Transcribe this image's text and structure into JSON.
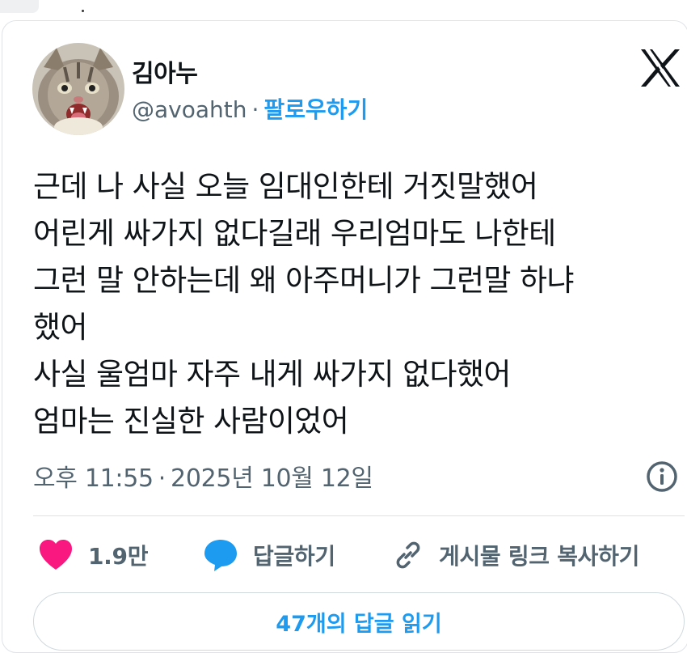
{
  "tweet": {
    "author": {
      "display_name": "김아누",
      "handle": "@avoahth",
      "follow_label": "팔로우하기",
      "avatar_icon": "cat-avatar"
    },
    "brand_icon": "x-logo-icon",
    "text_lines": [
      "근데 나 사실 오늘 임대인한테 거짓말했어",
      "어린게 싸가지 없다길래 우리엄마도 나한테",
      "그런 말 안하는데 왜 아주머니가 그런말 하냐",
      "했어",
      "사실 울엄마 자주 내게 싸가지 없다했어",
      "엄마는 진실한 사람이었어"
    ],
    "time": "오후 11:55",
    "date": "2025년 10월 12일",
    "separator": "·",
    "info_icon": "info-icon",
    "actions": {
      "like_count": "1.9만",
      "reply_label": "답글하기",
      "copy_link_label": "게시물 링크 복사하기"
    },
    "read_replies_label": "47개의 답글 읽기",
    "colors": {
      "accent": "#1d9bf0",
      "like": "#f91880",
      "reply_bubble": "#1d9bf0",
      "muted_text": "#536471",
      "text": "#0f1419"
    }
  }
}
